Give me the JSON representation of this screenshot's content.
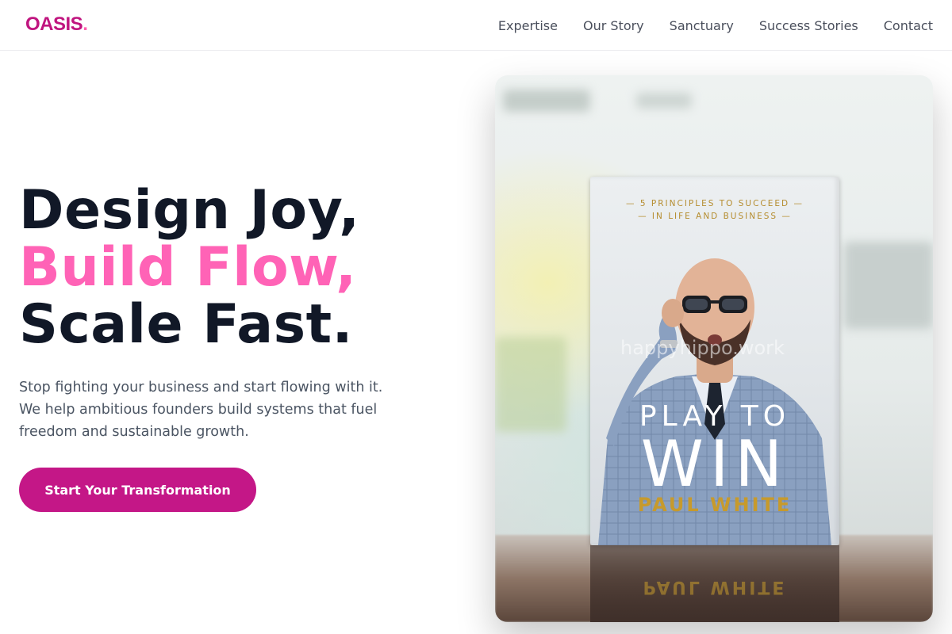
{
  "brand": {
    "logo_text": "OASIS",
    "logo_dot": ".",
    "primary_color": "#c41787",
    "accent_color": "#ff63b6"
  },
  "nav": {
    "items": [
      {
        "label": "Expertise"
      },
      {
        "label": "Our Story"
      },
      {
        "label": "Sanctuary"
      },
      {
        "label": "Success Stories"
      },
      {
        "label": "Contact"
      }
    ]
  },
  "hero": {
    "headline_line1": "Design Joy,",
    "headline_line2": "Build Flow,",
    "headline_line3": "Scale Fast.",
    "subtext": "Stop fighting your business and start flowing with it. We help ambitious founders build systems that fuel freedom and sustainable growth.",
    "cta_label": "Start Your Transformation"
  },
  "hero_image": {
    "book_tagline_line1": "— 5 PRINCIPLES TO SUCCEED —",
    "book_tagline_line2": "— IN LIFE AND BUSINESS —",
    "book_title_line1": "PLAY TO",
    "book_title_line2": "WIN",
    "book_author": "PAUL WHITE",
    "watermark": "happyhippo.work"
  }
}
